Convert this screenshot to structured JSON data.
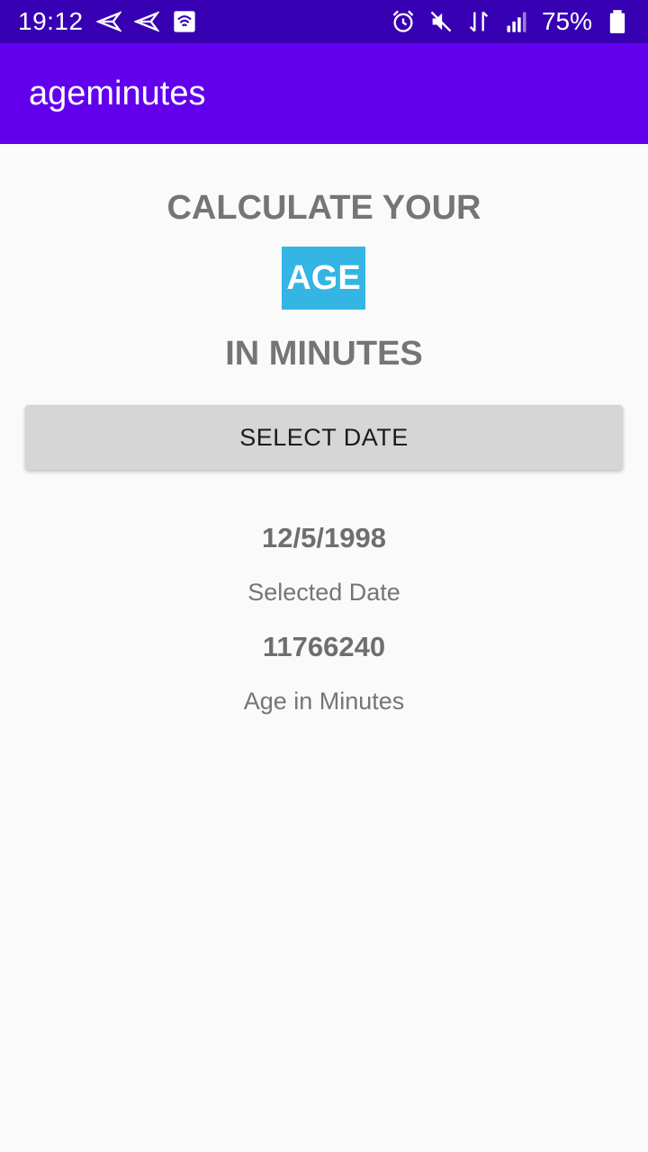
{
  "status_bar": {
    "time": "19:12",
    "battery_percent": "75%",
    "icons_left": [
      "send-icon",
      "send-icon",
      "photo-icon"
    ],
    "icons_right": [
      "alarm-icon",
      "mute-icon",
      "data-icon",
      "signal-icon",
      "battery-icon"
    ]
  },
  "app_bar": {
    "title": "ageminutes",
    "color": "#6200ee"
  },
  "main": {
    "heading_top": "CALCULATE YOUR",
    "highlight": "AGE",
    "highlight_color": "#34b5e4",
    "heading_bottom": "IN MINUTES",
    "select_button_label": "SELECT DATE",
    "selected_date_value": "12/5/1998",
    "selected_date_label": "Selected Date",
    "age_minutes_value": "11766240",
    "age_minutes_label": "Age in Minutes"
  }
}
